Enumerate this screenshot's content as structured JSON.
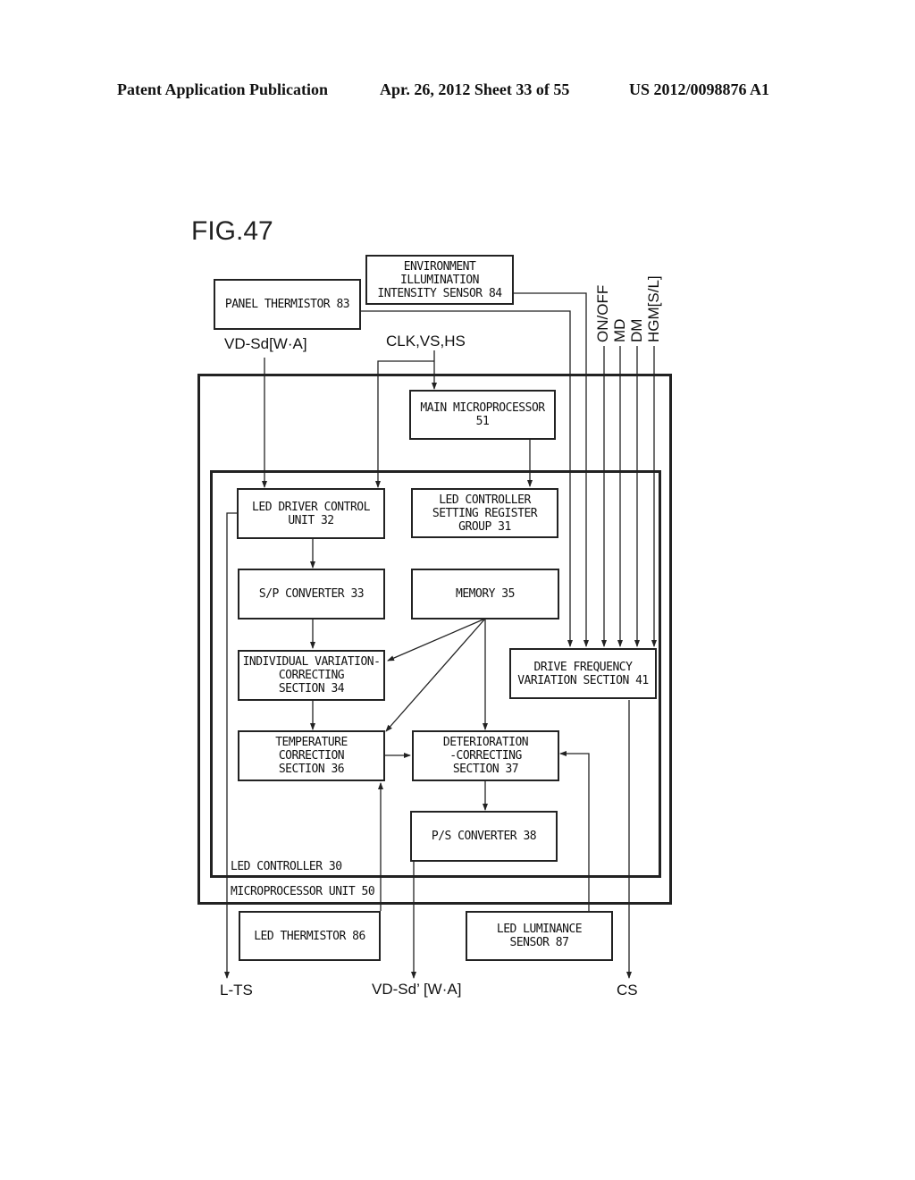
{
  "header": {
    "publication": "Patent Application Publication",
    "date_sheet": "Apr. 26, 2012  Sheet 33 of 55",
    "patent_number": "US 2012/0098876 A1"
  },
  "figure": {
    "title": "FIG.47",
    "frames": {
      "microprocessor_unit": "MICROPROCESSOR UNIT 50",
      "led_controller": "LED CONTROLLER 30"
    },
    "blocks": {
      "panel_thermistor": "PANEL THERMISTOR 83",
      "env_sensor": "ENVIRONMENT\nILLUMINATION\nINTENSITY SENSOR 84",
      "main_microprocessor": "MAIN MICROPROCESSOR\n51",
      "led_driver_control": "LED DRIVER CONTROL\nUNIT 32",
      "led_setting_register": "LED CONTROLLER\nSETTING REGISTER\nGROUP 31",
      "sp_converter": "S/P CONVERTER 33",
      "memory": "MEMORY 35",
      "individual_variation": "INDIVIDUAL VARIATION-\nCORRECTING\nSECTION 34",
      "drive_frequency": "DRIVE FREQUENCY\nVARIATION SECTION 41",
      "temperature_correction": "TEMPERATURE\nCORRECTION\nSECTION 36",
      "deterioration_correcting": "DETERIORATION\n-CORRECTING\nSECTION 37",
      "ps_converter": "P/S CONVERTER 38",
      "led_thermistor": "LED THERMISTOR 86",
      "led_luminance_sensor": "LED LUMINANCE\nSENSOR 87"
    },
    "signals": {
      "vd_sd_in": "VD-Sd[W·A]",
      "clk_vs_hs": "CLK,VS,HS",
      "on_off": "ON/OFF",
      "md": "MD",
      "dm": "DM",
      "hgm": "HGM[S/L]",
      "l_ts": "L-TS",
      "vd_sd_out": "VD-Sd’ [W·A]",
      "cs": "CS"
    }
  }
}
